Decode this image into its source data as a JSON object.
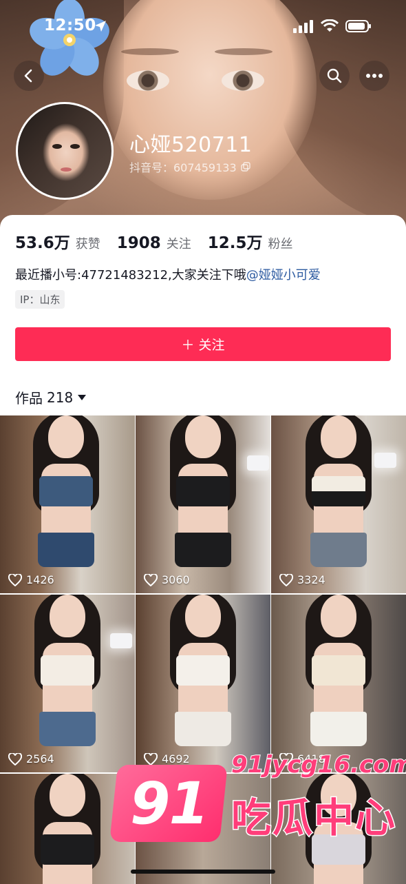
{
  "status_bar": {
    "time": "12:50"
  },
  "header": {
    "nickname": "心娅520711",
    "douyin_id": "抖音号：607459133"
  },
  "stats": [
    {
      "value": "53.6万",
      "label": "获赞"
    },
    {
      "value": "1908",
      "label": "关注"
    },
    {
      "value": "12.5万",
      "label": "粉丝"
    }
  ],
  "bio": {
    "text": "最近播小号:47721483212,大家关注下哦",
    "mention": "@娅娅小可爱"
  },
  "ip": "IP：山东",
  "follow_button": "＋ 关注",
  "works": {
    "label": "作品",
    "count": "218"
  },
  "grid": [
    {
      "likes": "1426"
    },
    {
      "likes": "3060"
    },
    {
      "likes": "3324"
    },
    {
      "likes": "2564"
    },
    {
      "likes": "4692"
    },
    {
      "likes": "6418"
    }
  ],
  "watermark": {
    "badge": "91",
    "url": "91jycg16.com",
    "text": "吃瓜中心"
  },
  "colors": {
    "accent": "#fe2c55",
    "mention": "#2c5aa0"
  }
}
